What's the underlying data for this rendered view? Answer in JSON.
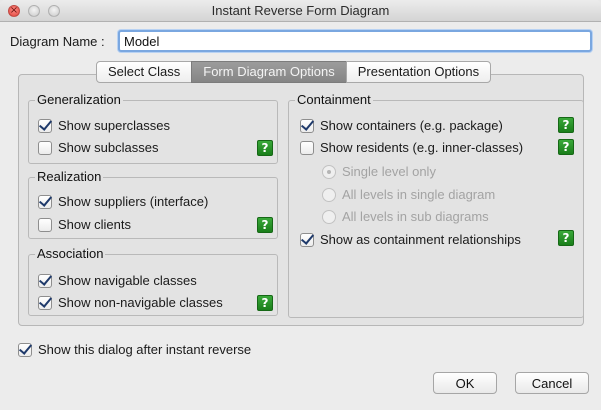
{
  "window": {
    "title": "Instant Reverse Form Diagram",
    "controls": {
      "close_glyph": "×"
    }
  },
  "diagram_name": {
    "label": "Diagram Name :",
    "value": "Model"
  },
  "tabs": [
    {
      "label": "Select Class",
      "active": false
    },
    {
      "label": "Form Diagram Options",
      "active": true
    },
    {
      "label": "Presentation Options",
      "active": false
    }
  ],
  "generalization": {
    "title": "Generalization",
    "show_superclasses": {
      "label": "Show superclasses",
      "checked": true
    },
    "show_subclasses": {
      "label": "Show subclasses",
      "checked": false
    }
  },
  "realization": {
    "title": "Realization",
    "show_suppliers": {
      "label": "Show suppliers (interface)",
      "checked": true
    },
    "show_clients": {
      "label": "Show clients",
      "checked": false
    }
  },
  "association": {
    "title": "Association",
    "show_navigable": {
      "label": "Show navigable classes",
      "checked": true
    },
    "show_non_navigable": {
      "label": "Show non-navigable classes",
      "checked": true
    }
  },
  "containment": {
    "title": "Containment",
    "show_containers": {
      "label": "Show containers (e.g. package)",
      "checked": true
    },
    "show_residents": {
      "label": "Show residents (e.g. inner-classes)",
      "checked": false
    },
    "single_level_only": {
      "label": "Single level only",
      "selected": true
    },
    "all_levels_single": {
      "label": "All levels in single diagram",
      "selected": false
    },
    "all_levels_sub": {
      "label": "All levels in sub diagrams",
      "selected": false
    },
    "show_as_containment": {
      "label": "Show as containment relationships",
      "checked": true
    }
  },
  "help_glyph": "?",
  "show_dialog": {
    "label": "Show this dialog after instant reverse",
    "checked": true
  },
  "buttons": {
    "ok": "OK",
    "cancel": "Cancel"
  },
  "colors": {
    "help_badge": "#2a962a",
    "focus_ring": "#7aa7e0",
    "active_tab": "#8f8f8f"
  }
}
